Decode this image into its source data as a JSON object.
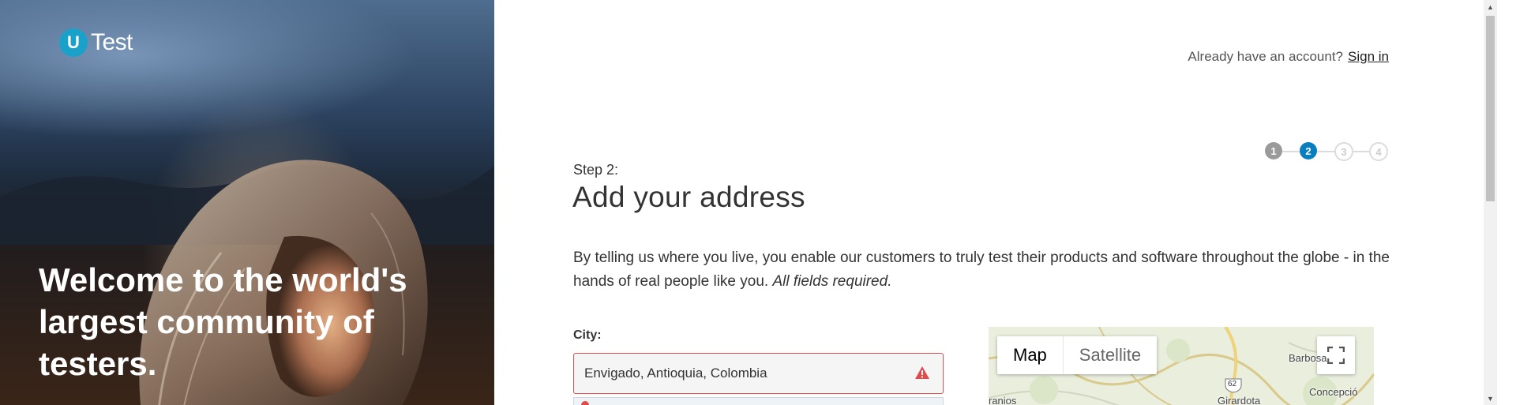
{
  "brand": {
    "logo_letter": "U",
    "logo_text": "Test",
    "accent": "#1aa1c9"
  },
  "hero": {
    "title": "Welcome to the world's largest community of testers."
  },
  "header": {
    "already_text": "Already have an account?",
    "signin_label": "Sign in"
  },
  "steps": {
    "items": [
      {
        "label": "1",
        "state": "done"
      },
      {
        "label": "2",
        "state": "active"
      },
      {
        "label": "3",
        "state": "future"
      },
      {
        "label": "4",
        "state": "future"
      }
    ],
    "active_color": "#0a7fc0"
  },
  "form": {
    "step_label": "Step 2:",
    "heading": "Add your address",
    "intro_text": "By telling us where you live, you enable our customers to truly test their products and software throughout the globe - in the hands of real people like you.",
    "intro_em": "All fields required.",
    "city_label": "City:",
    "city_value": "Envigado, Antioquia, Colombia",
    "error_color": "#e04b4b"
  },
  "map": {
    "map_label": "Map",
    "satellite_label": "Satellite",
    "places": [
      "Barbosa",
      "Concepció",
      "Girardota",
      "ranios"
    ],
    "route_number": "62"
  }
}
